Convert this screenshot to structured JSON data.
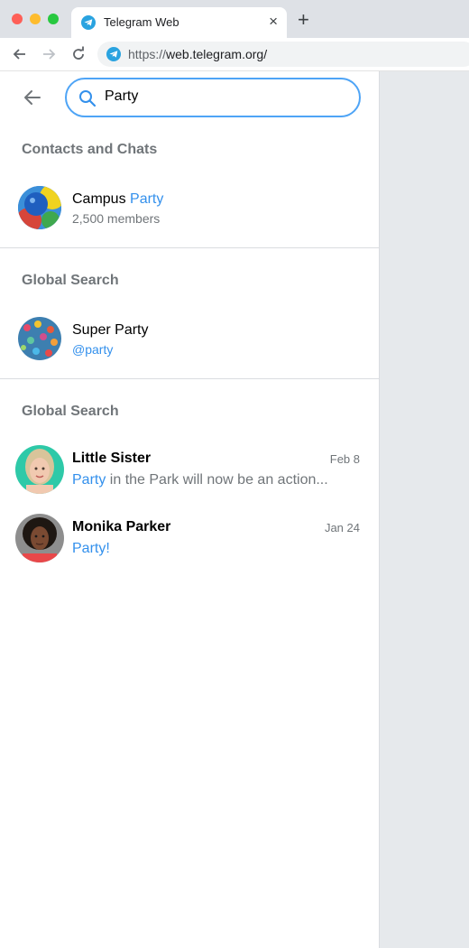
{
  "browser": {
    "tab_title": "Telegram Web",
    "tab_close": "×",
    "new_tab": "+",
    "url_scheme": "https://",
    "url_host": "web.telegram.org/"
  },
  "search": {
    "value": "Party"
  },
  "sections": {
    "contacts_title": "Contacts and Chats",
    "global_title_1": "Global Search",
    "global_title_2": "Global Search"
  },
  "results": {
    "campus": {
      "name_prefix": "Campus ",
      "name_highlight": "Party",
      "sub": "2,500 members"
    },
    "super": {
      "name": "Super Party",
      "sub": "@party"
    },
    "sister": {
      "name": "Little Sister",
      "date": "Feb 8",
      "msg_highlight": "Party",
      "msg_rest": " in the Park will now be an action..."
    },
    "monika": {
      "name": "Monika Parker",
      "date": "Jan 24",
      "msg_highlight": "Party",
      "msg_rest": "!"
    }
  },
  "colors": {
    "accent": "#3390ec",
    "search_border": "#4ea4f6",
    "secondary_text": "#707579",
    "right_pane": "#e6e9ec"
  }
}
